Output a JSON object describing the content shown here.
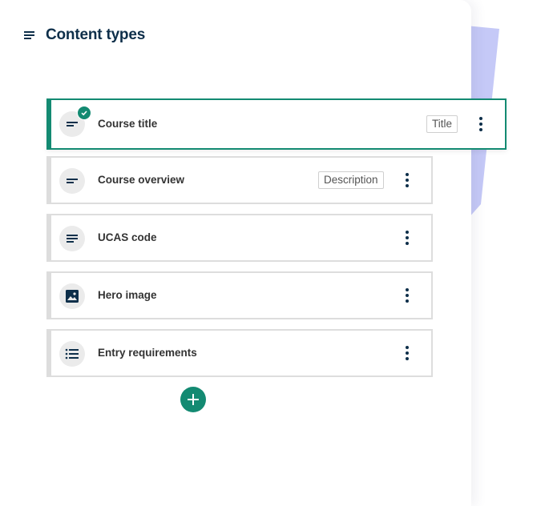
{
  "header": {
    "title": "Content types",
    "icon": "short-text-icon"
  },
  "items": [
    {
      "label": "Course title",
      "tag": "Title",
      "icon": "short-text-icon",
      "selected": true
    },
    {
      "label": "Course overview",
      "tag": "Description",
      "icon": "short-text-icon",
      "selected": false
    },
    {
      "label": "UCAS code",
      "tag": "",
      "icon": "notes-icon",
      "selected": false
    },
    {
      "label": "Hero image",
      "tag": "",
      "icon": "image-icon",
      "selected": false
    },
    {
      "label": "Entry requirements",
      "tag": "",
      "icon": "list-icon",
      "selected": false
    }
  ],
  "add_button": {
    "icon": "plus-icon"
  },
  "colors": {
    "accent": "#138a72",
    "navy": "#0e2f4a",
    "decor": "#c5c9f7"
  }
}
